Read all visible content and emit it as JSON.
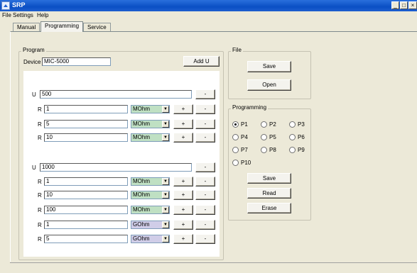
{
  "window": {
    "title": "SRP"
  },
  "menu": [
    "File",
    "Settings",
    "Help"
  ],
  "tabs": [
    {
      "label": "Manual",
      "active": false
    },
    {
      "label": "Programming",
      "active": true
    },
    {
      "label": "Service",
      "active": false
    }
  ],
  "program": {
    "caption": "Program",
    "device_label": "Device",
    "device_value": "MIC-5000",
    "add_u_label": "Add U",
    "u_label": "U",
    "r_label": "R",
    "plus": "+",
    "minus": "-",
    "groups": [
      {
        "u_value": "500",
        "rows": [
          {
            "value": "1",
            "unit": "MOhm"
          },
          {
            "value": "5",
            "unit": "MOhm"
          },
          {
            "value": "10",
            "unit": "MOhm"
          }
        ]
      },
      {
        "u_value": "1000",
        "rows": [
          {
            "value": "1",
            "unit": "MOhm"
          },
          {
            "value": "10",
            "unit": "MOhm"
          },
          {
            "value": "100",
            "unit": "MOhm"
          },
          {
            "value": "1",
            "unit": "GOhm"
          },
          {
            "value": "5",
            "unit": "GOhm"
          }
        ]
      }
    ]
  },
  "file": {
    "caption": "File",
    "save_label": "Save",
    "open_label": "Open"
  },
  "programming": {
    "caption": "Programming",
    "slots": [
      "P1",
      "P2",
      "P3",
      "P4",
      "P5",
      "P6",
      "P7",
      "P8",
      "P9",
      "P10"
    ],
    "selected": "P1",
    "save_label": "Save",
    "read_label": "Read",
    "erase_label": "Erase"
  },
  "colors": {
    "mohm_combo": "#bfe0c3",
    "gohm_combo": "#d0cde8",
    "title_bar": "#0a4fc4"
  }
}
